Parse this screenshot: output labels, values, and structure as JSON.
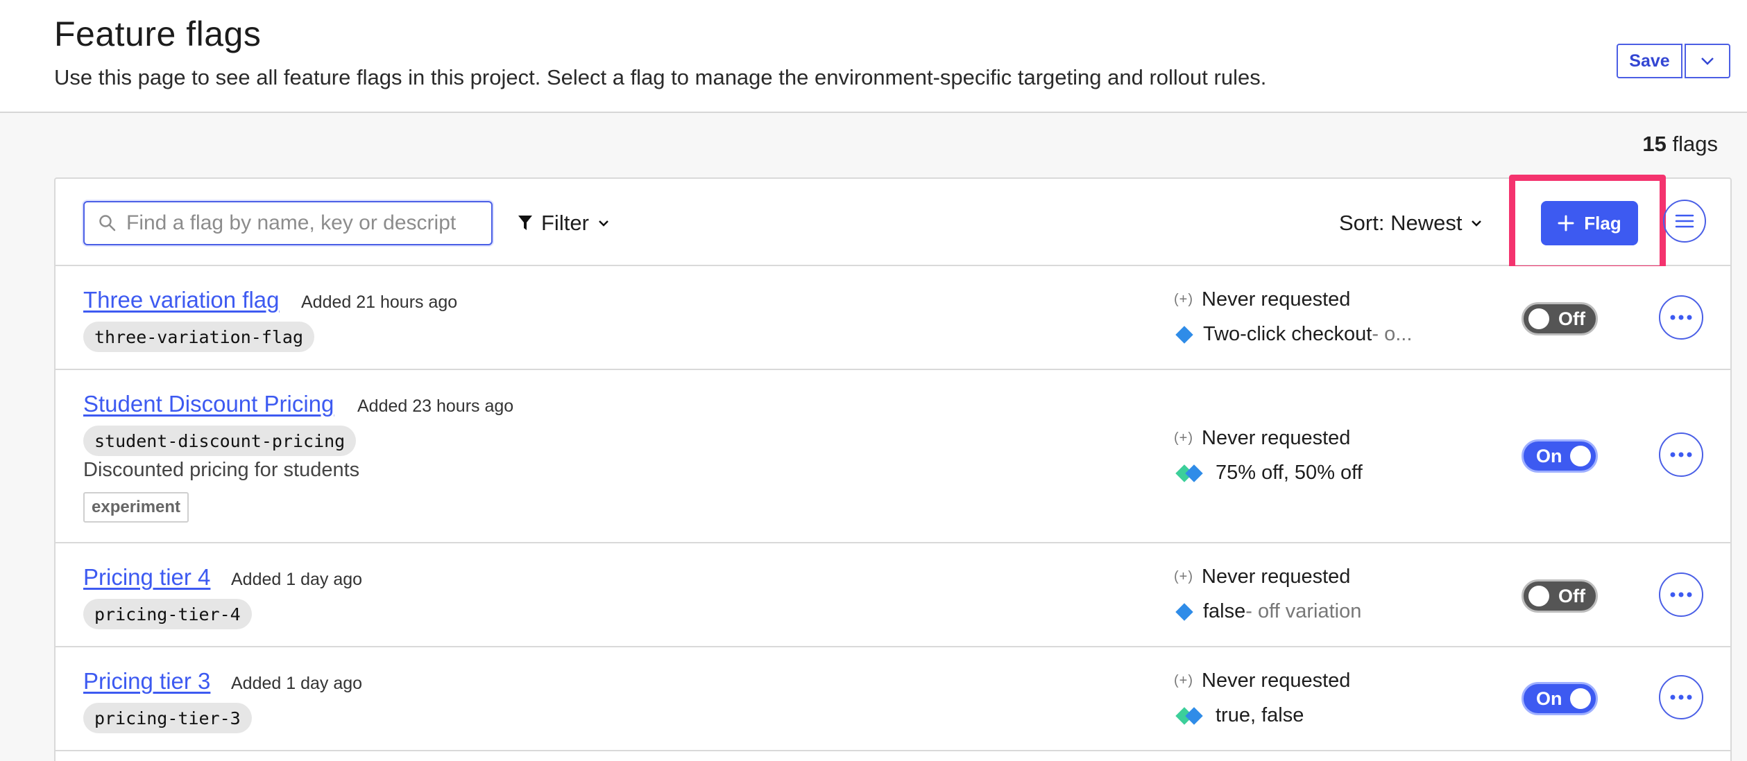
{
  "header": {
    "title": "Feature flags",
    "description": "Use this page to see all feature flags in this project. Select a flag to manage the environment-specific targeting and rollout rules.",
    "save_label": "Save"
  },
  "summary": {
    "count": "15",
    "unit": "flags"
  },
  "toolbar": {
    "search_placeholder": "Find a flag by name, key or descript",
    "filter_label": "Filter",
    "sort_label": "Sort: Newest",
    "add_flag_label": "Flag"
  },
  "colors": {
    "accent": "#3d5af1",
    "highlight": "#f4336e",
    "toggle_off": "#555555",
    "variation_blue": "#2f8ce8",
    "variation_teal": "#3ccf9a"
  },
  "flags": [
    {
      "name": "Three variation flag",
      "added": "Added 21 hours ago",
      "key": "three-variation-flag",
      "requests": "Never requested",
      "requests_icon": "(+)",
      "variation": "Two-click checkout",
      "variation_note": " - o...",
      "toggle": "Off"
    },
    {
      "name": "Student Discount Pricing",
      "added": "Added 23 hours ago",
      "key": "student-discount-pricing",
      "description": "Discounted pricing for students",
      "tag": "experiment",
      "requests": "Never requested",
      "requests_icon": "(+)",
      "variation": "75% off, 50% off",
      "toggle": "On"
    },
    {
      "name": "Pricing tier 4",
      "added": "Added 1 day ago",
      "key": "pricing-tier-4",
      "requests": "Never requested",
      "requests_icon": "(+)",
      "variation": "false",
      "variation_note": " - off variation",
      "toggle": "Off"
    },
    {
      "name": "Pricing tier 3",
      "added": "Added 1 day ago",
      "key": "pricing-tier-3",
      "requests": "Never requested",
      "requests_icon": "(+)",
      "variation": "true, false",
      "toggle": "On"
    }
  ]
}
